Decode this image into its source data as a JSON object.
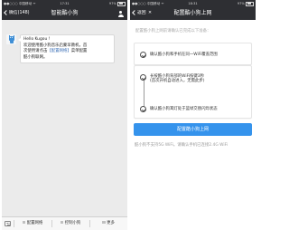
{
  "left_screen": {
    "status": {
      "carrier": "●●○○○ 中国移动 ᯤ",
      "time": "17:31",
      "battery": "97%"
    },
    "nav": {
      "back": "微信(148)",
      "title": "智能酷小狗",
      "person_icon": "person-icon"
    },
    "message": {
      "avatar_icon": "dog-avatar-icon",
      "greeting": "Hello Kugou !",
      "line1": "欢迎使用酷小狗音乐启蒙早教机，首",
      "line2_pre": "次使用请点击",
      "line2_link": "【配置网络】",
      "line2_post": "菜单配置",
      "line3": "酷小狗联网。"
    },
    "menu": [
      "配置网络",
      "控制小狗",
      "更多"
    ],
    "keyboard_icon": "keyboard-icon",
    "menu_icon": "menu-lines-icon"
  },
  "right_screen": {
    "status": {
      "carrier": "●●○○○ 中国移动 ᯤ",
      "time": "18:31",
      "battery": "97%"
    },
    "nav": {
      "back": "返回",
      "title": "配置酷小狗上网",
      "close": "✕"
    },
    "subtitle": "配置酷小狗上网前请确认已完成以下准备：",
    "steps": [
      {
        "text": "确认酷小狗和手机在同一WiFi覆盖范围",
        "sub": ""
      },
      {
        "text": "长按酷小狗背部的WiFi按键3秒",
        "sub": "(首次开机自动进入，无需此步)"
      },
      {
        "text": "确认酷小狗耳灯处于蓝绿交替闪烁状态",
        "sub": ""
      }
    ],
    "check_icon": "check-circle-icon",
    "button": "配置酷小狗上网",
    "hint": "酷小狗不支持5G WiFi。请确认手机已连接2.4G WiFi"
  }
}
